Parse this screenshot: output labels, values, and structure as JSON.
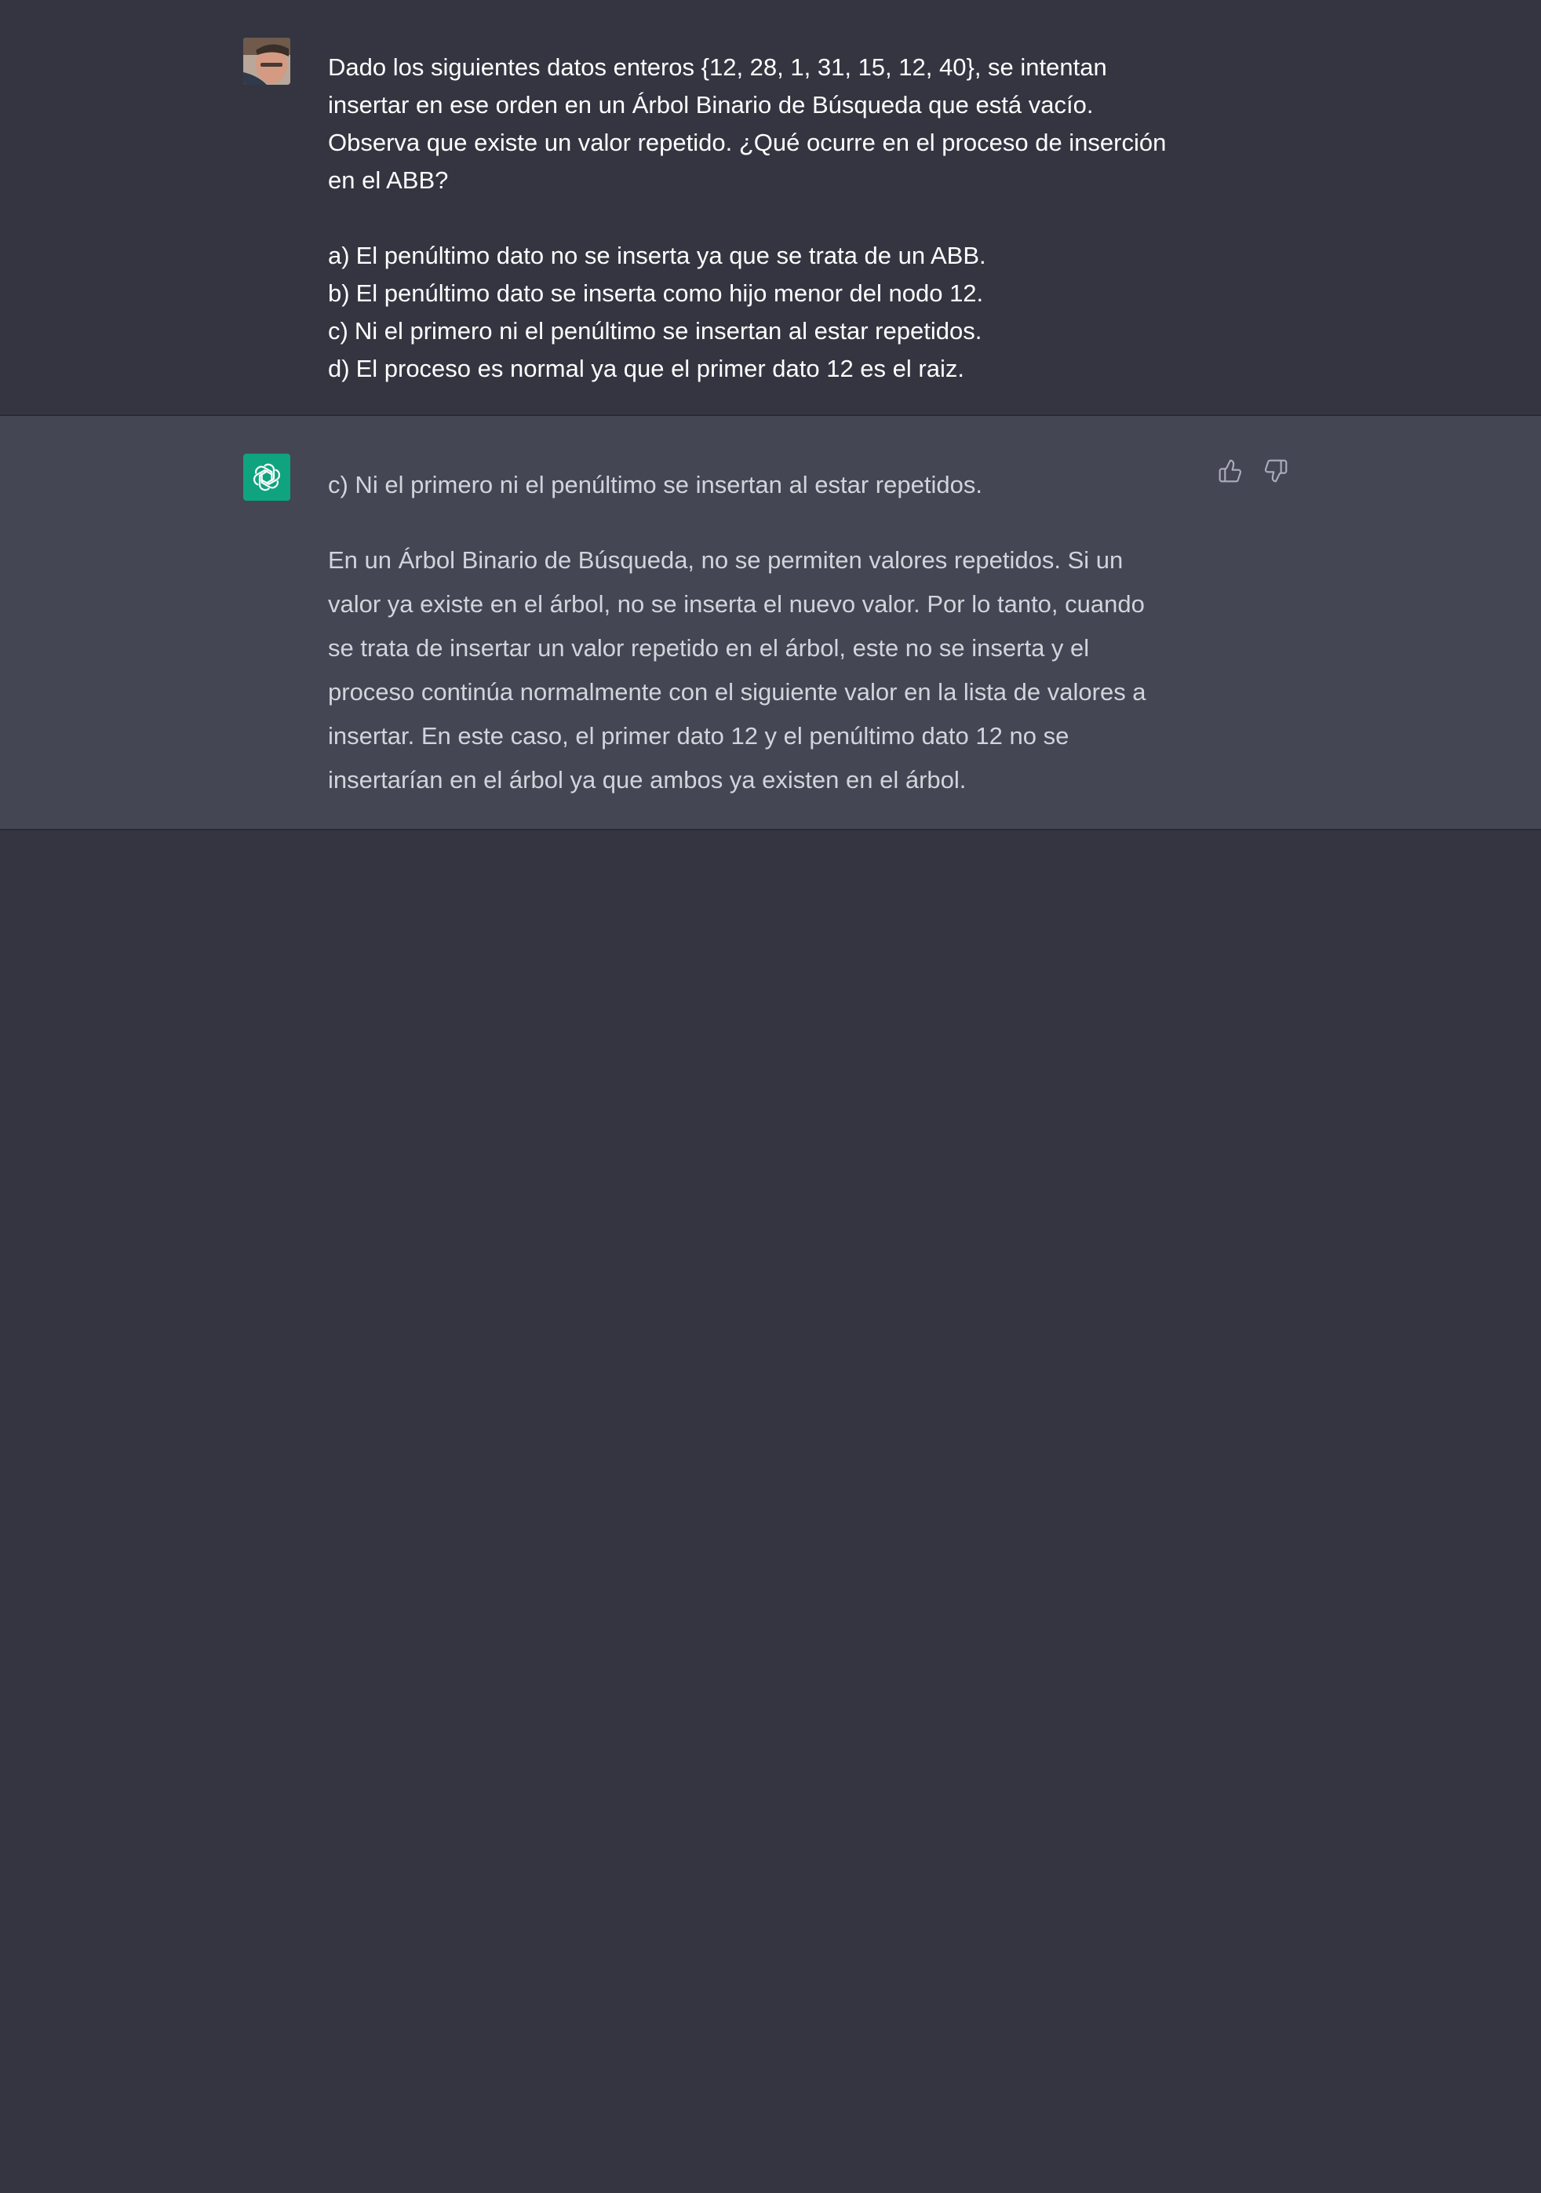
{
  "conversation": {
    "user_message": {
      "question_lines": [
        "Dado los siguientes datos enteros {12, 28, 1, 31, 15, 12, 40}, se intentan",
        "insertar en ese orden en un Árbol Binario de Búsqueda que está vacío.",
        "Observa que existe un valor repetido. ¿Qué ocurre en el proceso de inserción",
        "en el ABB?"
      ],
      "options": [
        {
          "letter": "a)",
          "text": "El penúltimo dato no se inserta ya que se trata de un ABB."
        },
        {
          "letter": "b)",
          "text": "El penúltimo dato se inserta como hijo menor del nodo 12."
        },
        {
          "letter": "c)",
          "text": "Ni el primero ni el penúltimo se insertan al estar repetidos."
        },
        {
          "letter": "d)",
          "text": "El proceso es normal ya que el primer dato 12 es el raiz."
        }
      ]
    },
    "assistant_message": {
      "answer": "c) Ni el primero ni el penúltimo se insertan al estar repetidos.",
      "explanation_lines": [
        "En un Árbol Binario de Búsqueda, no se permiten valores repetidos. Si un",
        "valor ya existe en el árbol, no se inserta el nuevo valor. Por lo tanto, cuando",
        "se trata de insertar un valor repetido en el árbol, este no se inserta y el",
        "proceso continúa normalmente con el siguiente valor en la lista de valores a",
        "insertar. En este caso, el primer dato 12 y el penúltimo dato 12 no se",
        "insertarían en el árbol ya que ambos ya existen en el árbol."
      ]
    },
    "feedback_icons": [
      "thumbs-up-icon",
      "thumbs-down-icon"
    ],
    "colors": {
      "background": "#343541",
      "assistant_background": "#444654",
      "bot_avatar": "#10a37f"
    }
  }
}
